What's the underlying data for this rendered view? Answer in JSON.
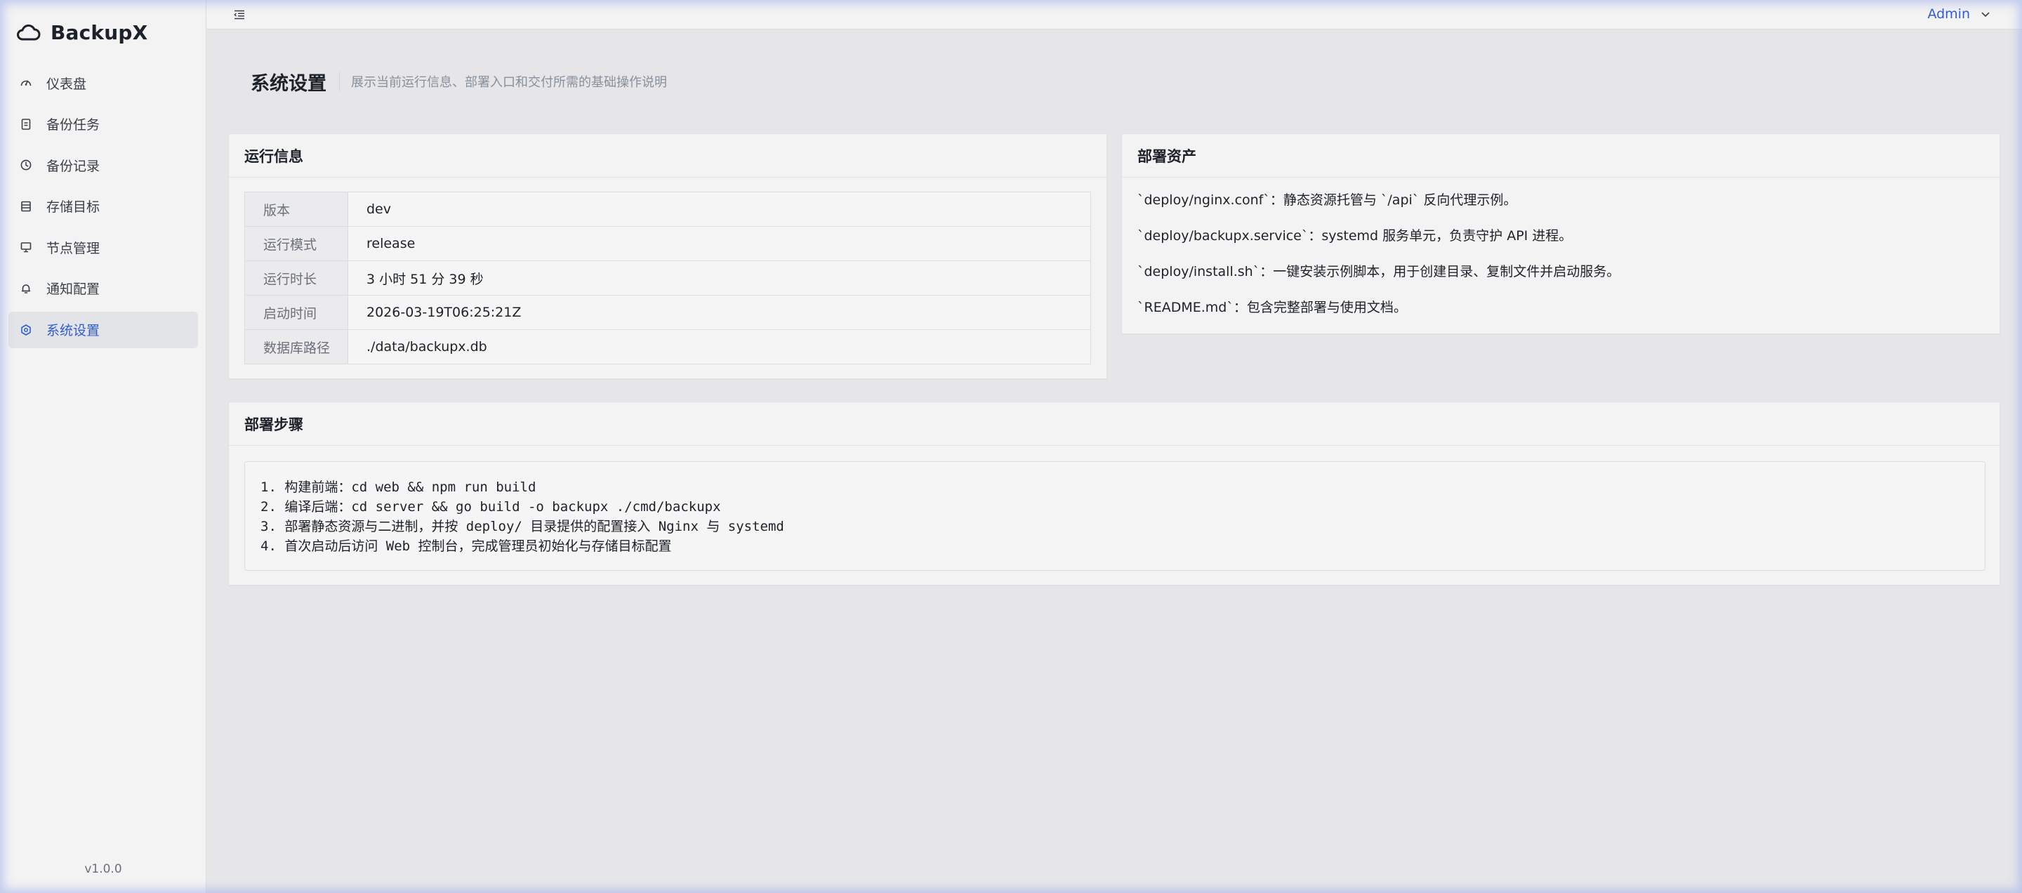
{
  "app": {
    "title": "BackupX",
    "version": "v1.0.0"
  },
  "sidebar": {
    "items": [
      {
        "label": "仪表盘",
        "icon": "dashboard-icon",
        "active": false
      },
      {
        "label": "备份任务",
        "icon": "file-icon",
        "active": false
      },
      {
        "label": "备份记录",
        "icon": "history-icon",
        "active": false
      },
      {
        "label": "存储目标",
        "icon": "storage-icon",
        "active": false
      },
      {
        "label": "节点管理",
        "icon": "desktop-icon",
        "active": false
      },
      {
        "label": "通知配置",
        "icon": "bell-icon",
        "active": false
      },
      {
        "label": "系统设置",
        "icon": "settings-icon",
        "active": true
      }
    ]
  },
  "topbar": {
    "user": "Admin"
  },
  "page": {
    "title": "系统设置",
    "description": "展示当前运行信息、部署入口和交付所需的基础操作说明"
  },
  "run_info": {
    "title": "运行信息",
    "rows": [
      {
        "key": "版本",
        "value": "dev"
      },
      {
        "key": "运行模式",
        "value": "release"
      },
      {
        "key": "运行时长",
        "value": "3 小时 51 分 39 秒"
      },
      {
        "key": "启动时间",
        "value": "2026-03-19T06:25:21Z"
      },
      {
        "key": "数据库路径",
        "value": "./data/backupx.db"
      }
    ]
  },
  "assets": {
    "title": "部署资产",
    "items": [
      "`deploy/nginx.conf`：静态资源托管与 `/api` 反向代理示例。",
      "`deploy/backupx.service`：systemd 服务单元，负责守护 API 进程。",
      "`deploy/install.sh`：一键安装示例脚本，用于创建目录、复制文件并启动服务。",
      "`README.md`：包含完整部署与使用文档。"
    ]
  },
  "steps": {
    "title": "部署步骤",
    "lines": [
      "1. 构建前端：cd web && npm run build",
      "2. 编译后端：cd server && go build -o backupx ./cmd/backupx",
      "3. 部署静态资源与二进制，并按 deploy/ 目录提供的配置接入 Nginx 与 systemd",
      "4. 首次启动后访问 Web 控制台，完成管理员初始化与存储目标配置"
    ]
  },
  "colors": {
    "accent": "#2f5bd6",
    "sidebar_bg": "#f3f3f3",
    "page_bg": "#e6e6e8"
  }
}
